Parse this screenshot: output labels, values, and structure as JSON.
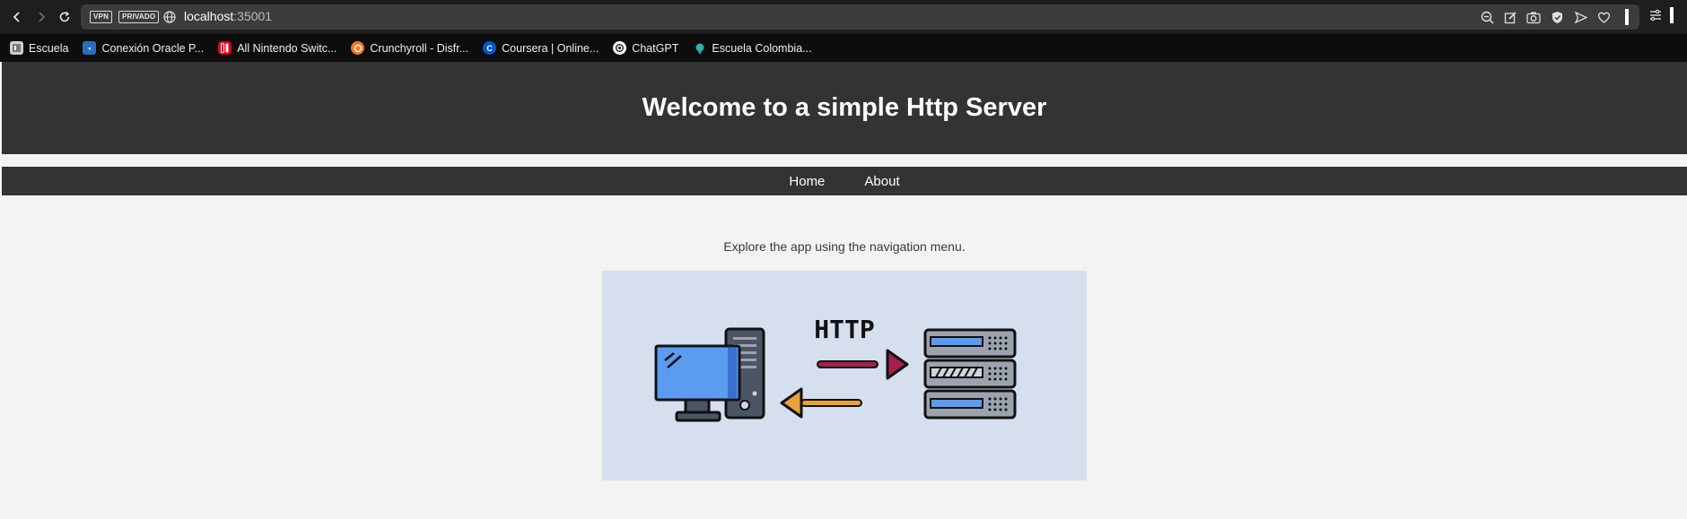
{
  "browser": {
    "badges": [
      "VPN",
      "PRIVADO"
    ],
    "url_host": "localhost",
    "url_port": ":35001",
    "bookmarks": [
      {
        "label": "Escuela",
        "icon": "bookmark-folder-icon",
        "color": "#d9d9d9"
      },
      {
        "label": "Conexión Oracle P...",
        "icon": "oracle-icon",
        "color": "#2a6fbf"
      },
      {
        "label": "All Nintendo Switc...",
        "icon": "nintendo-icon",
        "color": "#e60012"
      },
      {
        "label": "Crunchyroll - Disfr...",
        "icon": "crunchyroll-icon",
        "color": "#f47521"
      },
      {
        "label": "Coursera | Online...",
        "icon": "coursera-icon",
        "color": "#0056d2"
      },
      {
        "label": "ChatGPT",
        "icon": "chatgpt-icon",
        "color": "#ffffff"
      },
      {
        "label": "Escuela Colombia...",
        "icon": "escuela-colombia-icon",
        "color": "#2bb3a6"
      }
    ]
  },
  "page": {
    "title": "Welcome to a simple Http Server",
    "nav": {
      "home": "Home",
      "about": "About"
    },
    "tagline": "Explore the app using the navigation menu.",
    "illustration": {
      "label": "HTTP"
    }
  }
}
